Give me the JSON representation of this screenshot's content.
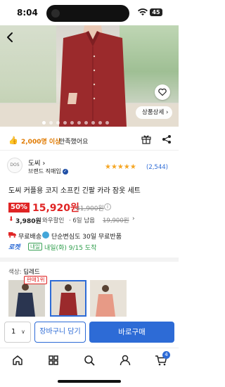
{
  "status_bar": {
    "time": "8:04",
    "battery": "45"
  },
  "hero": {
    "detail_button": "상품상세 ›",
    "image_count": 10,
    "current_image": 1
  },
  "satisfaction": {
    "count": "2,000명 이상",
    "message": "만족했어요"
  },
  "seller": {
    "logo_text": "DOS",
    "name": "도씨 ›",
    "badge": "브랜드 직매입",
    "rating_stars": "★★★★★",
    "rating": 5,
    "review_count": "(2,544)"
  },
  "product": {
    "title": "도씨 커플용 코지 소프킨 긴팔 카라 잠옷 세트",
    "discount": "50%",
    "price": "15,920원",
    "original_price": "31,900원",
    "wow_price": "3,980원",
    "wow_label": "와우할인",
    "stock_left": "· 6일 남음",
    "wow_original": "19,900원",
    "free_shipping": "무료배송",
    "return_text": "단순변심도 30일 무료반품",
    "rocket": "로켓",
    "delivery_tag": "내일",
    "delivery_date": "내일(화) 9/15 도착"
  },
  "options": {
    "label": "색상:",
    "selected": "딥레드",
    "best_badge": "판매1위",
    "swatches": [
      {
        "name": "navy"
      },
      {
        "name": "deep-red"
      },
      {
        "name": "pink"
      }
    ]
  },
  "actions": {
    "qty": "1",
    "cart": "장바구니 담기",
    "buy": "바로구매"
  },
  "tabbar": {
    "cart_count": "4"
  },
  "colors": {
    "accent": "#2d6bd6",
    "price_red": "#e02424",
    "star": "#f5a623",
    "green": "#2d9d4a"
  }
}
